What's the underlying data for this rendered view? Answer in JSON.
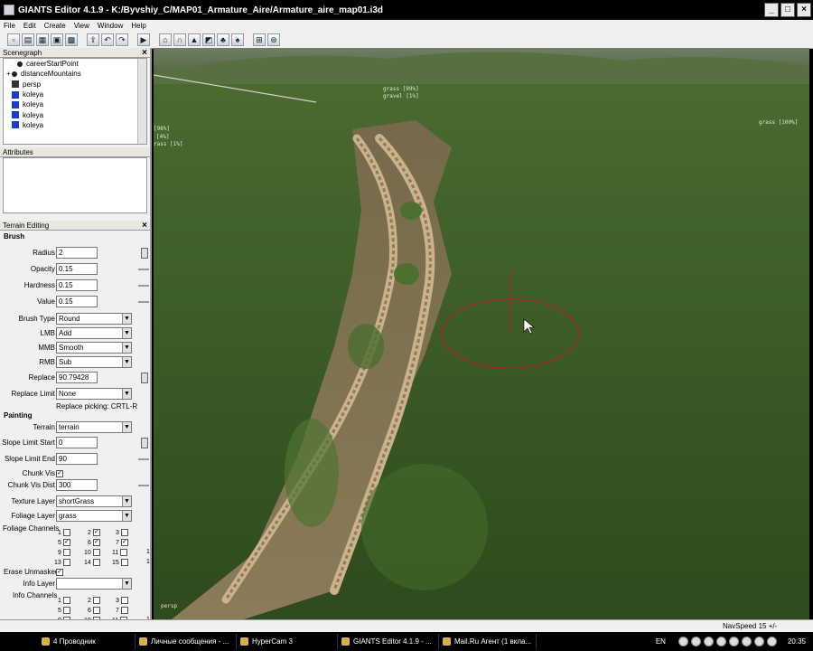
{
  "window": {
    "title": "GIANTS Editor 4.1.9 - K:/Byvshiy_C/MAP01_Armature_Aire/Armature_aire_map01.i3d",
    "controls": [
      "_",
      "□",
      "×"
    ]
  },
  "menu": [
    "File",
    "Edit",
    "Create",
    "View",
    "Window",
    "Help"
  ],
  "toolbar_icons": [
    "new-icon",
    "open-icon",
    "import-icon",
    "save-icon",
    "save-all-icon",
    "export-icon",
    "undo-icon",
    "redo-icon",
    "play-icon",
    "select-icon",
    "move-icon",
    "terrain-sculpt-icon",
    "terrain-paint-icon",
    "foliage-paint-icon",
    "tree-icon",
    "grid-icon",
    "snap-icon"
  ],
  "scenegraph": {
    "title": "Scenegraph",
    "items": [
      {
        "label": "careerStartPoint",
        "icon": "node-icon",
        "expander": ""
      },
      {
        "label": "distanceMountains",
        "icon": "node-icon",
        "expander": "+"
      },
      {
        "label": "persp",
        "icon": "camera-icon",
        "expander": ""
      },
      {
        "label": "koleya",
        "icon": "cube-icon",
        "expander": ""
      },
      {
        "label": "koleya",
        "icon": "cube-icon",
        "expander": ""
      },
      {
        "label": "koleya",
        "icon": "cube-icon",
        "expander": ""
      },
      {
        "label": "koleya",
        "icon": "cube-icon",
        "expander": ""
      }
    ]
  },
  "attributes": {
    "title": "Attributes"
  },
  "terrain": {
    "title": "Terrain Editing",
    "brush_section": "Brush",
    "radius_label": "Radius",
    "radius": "2",
    "opacity_label": "Opacity",
    "opacity": "0.15",
    "hardness_label": "Hardness",
    "hardness": "0.15",
    "value_label": "Value",
    "value": "0.15",
    "brush_type_label": "Brush Type",
    "brush_type": "Round",
    "lmb_label": "LMB",
    "lmb": "Add",
    "mmb_label": "MMB",
    "mmb": "Smooth",
    "rmb_label": "RMB",
    "rmb": "Sub",
    "replace_label": "Replace",
    "replace": "90.79428",
    "replace_limit_label": "Replace Limit",
    "replace_limit": "None",
    "replace_picking": "Replace picking: CRTL-R",
    "painting_section": "Painting",
    "terrain_label": "Terrain",
    "terrain": "terrain",
    "slope_start_label": "Slope Limit Start",
    "slope_start": "0",
    "slope_end_label": "Slope Limit End",
    "slope_end": "90",
    "chunk_vis_label": "Chunk Vis",
    "chunk_vis_dist_label": "Chunk Vis Dist",
    "chunk_vis_dist": "300",
    "texture_layer_label": "Texture Layer",
    "texture_layer": "shortGrass",
    "foliage_layer_label": "Foliage Layer",
    "foliage_layer": "grass",
    "foliage_channels_label": "Foliage Channels",
    "foliage_checked": [
      2,
      5,
      6,
      7,
      8
    ],
    "erase_unmasked_label": "Erase Unmasked",
    "info_layer_label": "Info Layer",
    "info_layer": "",
    "info_channels_label": "Info Channels"
  },
  "viewport": {
    "labels": [
      {
        "text": "grass [99%]"
      },
      {
        "text": "gravel [1%]"
      },
      {
        "text": "grass [100%]"
      },
      {
        "text": "[98%]"
      },
      {
        "text": "[4%]"
      },
      {
        "text": "rass [1%]"
      },
      {
        "text": "persp"
      }
    ]
  },
  "status": {
    "navspeed": "NavSpeed 15 +/-"
  },
  "taskbar": {
    "tasks": [
      {
        "label": "4 Проводник",
        "width": 108
      },
      {
        "label": "Личные сообщения - ...",
        "width": 112
      },
      {
        "label": "HyperCam 3",
        "width": 112
      },
      {
        "label": "GIANTS Editor 4.1.9 - ...",
        "width": 112
      },
      {
        "label": "Mail.Ru Агент (1 вкла...",
        "width": 108
      }
    ],
    "lang": "EN",
    "clock": "20:35"
  }
}
